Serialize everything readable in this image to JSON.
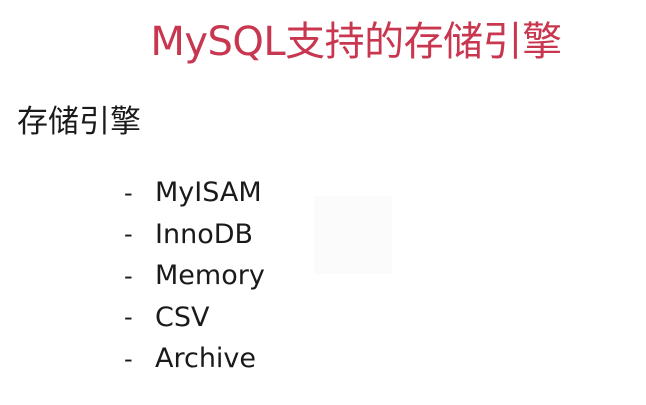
{
  "slide": {
    "title": "MySQL支持的存储引擎",
    "heading": "存储引擎",
    "bullet_marker": "-",
    "engines": [
      "MyISAM",
      "InnoDB",
      "Memory",
      "CSV",
      "Archive"
    ],
    "colors": {
      "title": "#c8364f",
      "text": "#1a1a1a",
      "background": "#ffffff"
    }
  }
}
